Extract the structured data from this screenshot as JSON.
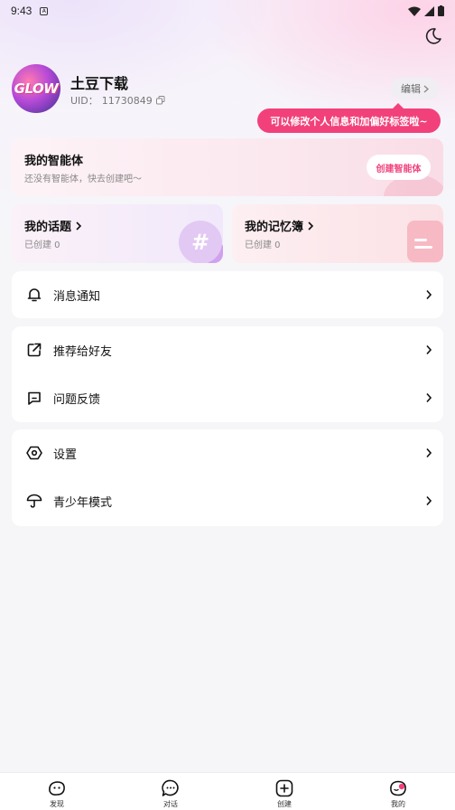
{
  "status_bar": {
    "time": "9:43",
    "notif_badge": "A"
  },
  "profile": {
    "avatar_text": "GLOW",
    "username": "土豆下载",
    "uid_label": "UID：",
    "uid_value": "11730849",
    "edit_label": "编辑",
    "tooltip": "可以修改个人信息和加偏好标签啦~"
  },
  "agent_card": {
    "title": "我的智能体",
    "subtitle": "还没有智能体，快去创建吧～",
    "button": "创建智能体"
  },
  "topic_card": {
    "title": "我的话题",
    "subtitle": "已创建 0",
    "deco": "#"
  },
  "memory_card": {
    "title": "我的记忆簿",
    "subtitle": "已创建 0"
  },
  "menu": {
    "notifications": "消息通知",
    "recommend": "推荐给好友",
    "feedback": "问题反馈",
    "settings": "设置",
    "youth_mode": "青少年模式"
  },
  "bottom_nav": [
    {
      "label": "发现",
      "icon": "discover-icon"
    },
    {
      "label": "对话",
      "icon": "chat-icon"
    },
    {
      "label": "创建",
      "icon": "create-icon"
    },
    {
      "label": "我的",
      "icon": "profile-icon"
    }
  ],
  "colors": {
    "accent": "#f2417a",
    "background": "#f6f6f8"
  }
}
